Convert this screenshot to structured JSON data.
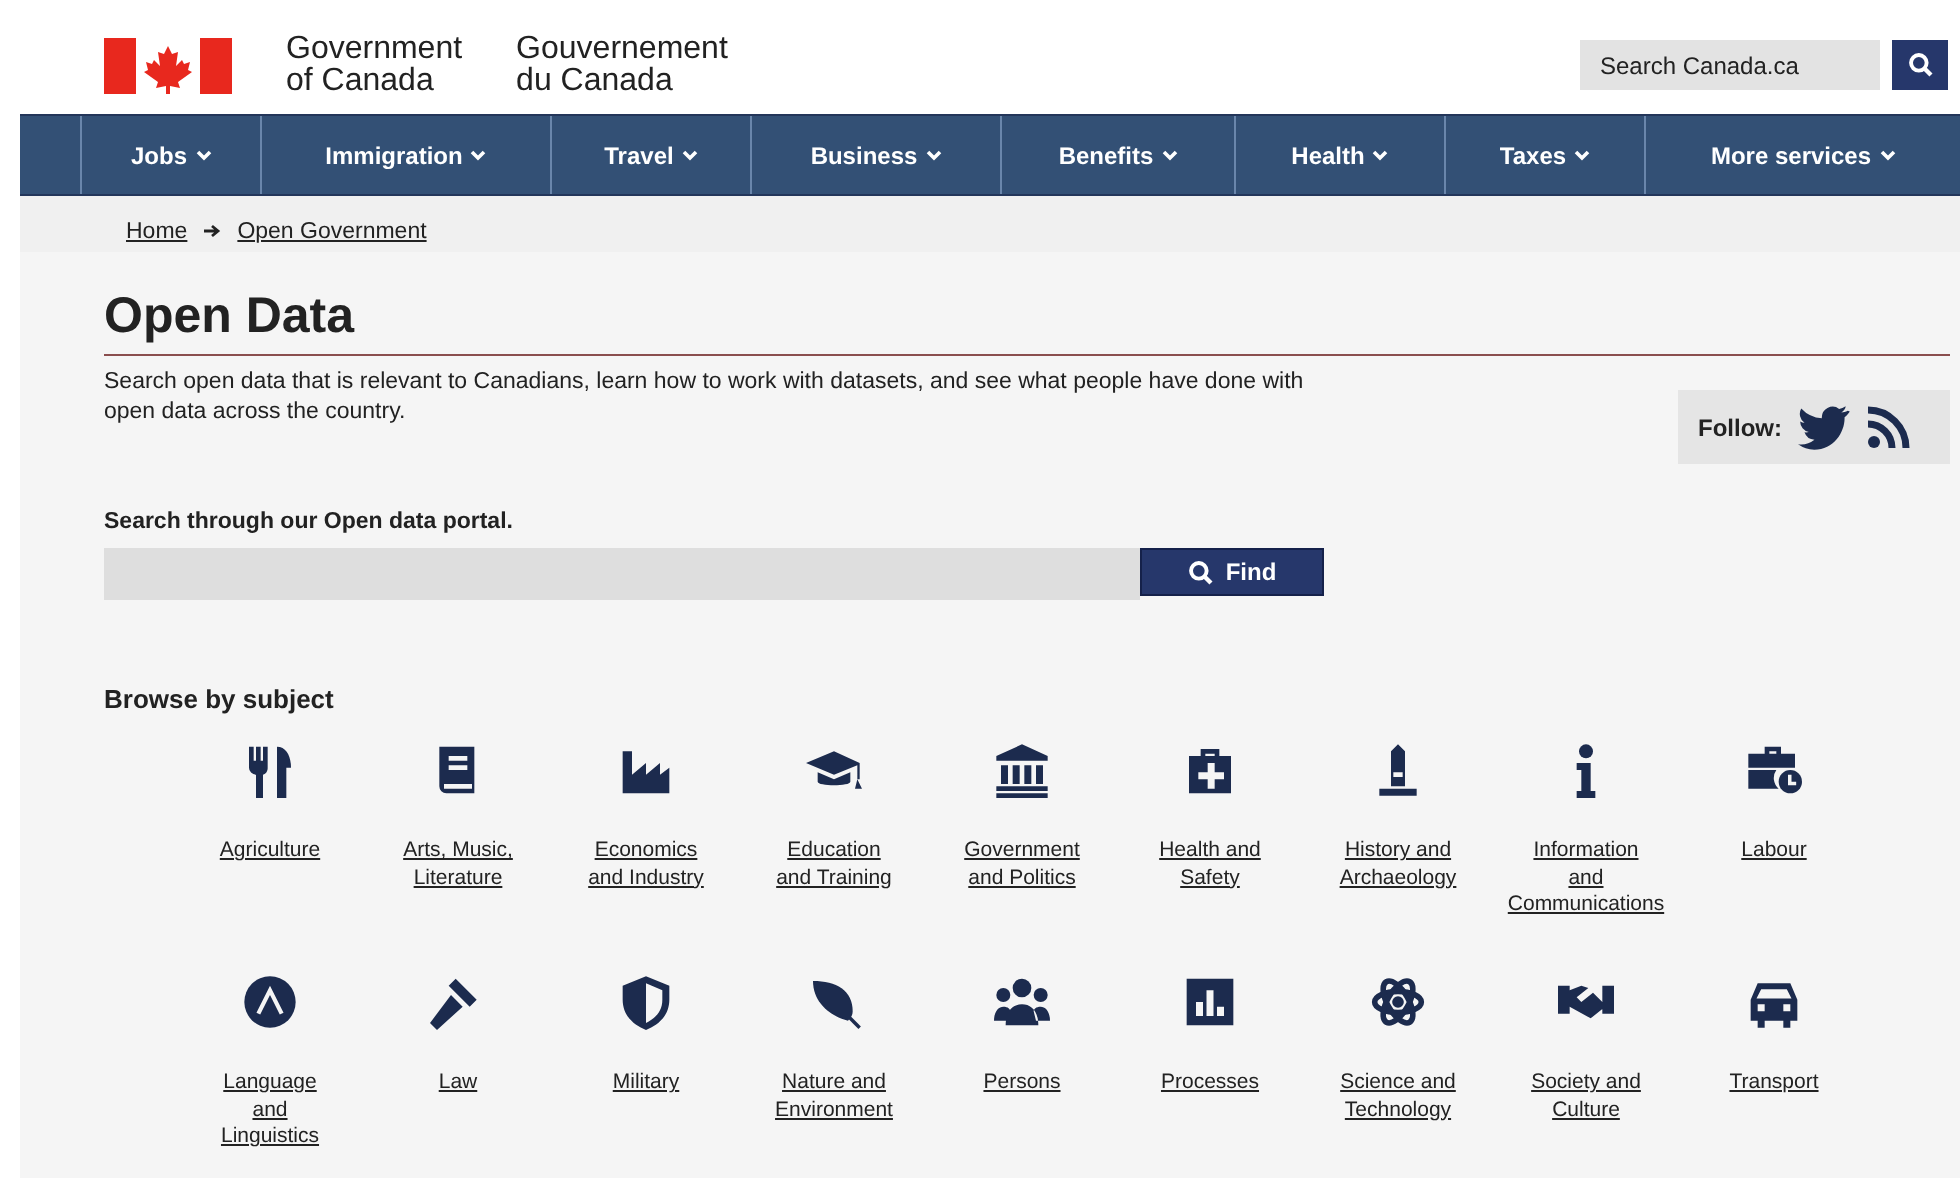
{
  "header": {
    "name_en": "Government\nof Canada",
    "name_fr": "Gouvernement\ndu Canada",
    "search": {
      "placeholder": "Search Canada.ca"
    }
  },
  "nav": [
    "Jobs",
    "Immigration",
    "Travel",
    "Business",
    "Benefits",
    "Health",
    "Taxes",
    "More services"
  ],
  "breadcrumb": [
    "Home",
    "Open Government"
  ],
  "title": "Open Data",
  "intro": "Search open data that is relevant to Canadians, learn how to work with datasets, and see what people have done with open data across the country.",
  "follow": {
    "label": "Follow:"
  },
  "portal": {
    "label": "Search through our Open data portal.",
    "button": "Find"
  },
  "browse": {
    "heading": "Browse by subject",
    "subjects": [
      {
        "label": "Agriculture"
      },
      {
        "label": "Arts, Music,\nLiterature"
      },
      {
        "label": "Economics\nand Industry"
      },
      {
        "label": "Education\nand Training"
      },
      {
        "label": "Government\nand Politics"
      },
      {
        "label": "Health and\nSafety"
      },
      {
        "label": "History and\nArchaeology"
      },
      {
        "label": "Information\nand\nCommunications"
      },
      {
        "label": "Labour"
      },
      {
        "label": "Language\nand\nLinguistics"
      },
      {
        "label": "Law"
      },
      {
        "label": "Military"
      },
      {
        "label": "Nature and\nEnvironment"
      },
      {
        "label": "Persons"
      },
      {
        "label": "Processes"
      },
      {
        "label": "Science and\nTechnology"
      },
      {
        "label": "Society and\nCulture"
      },
      {
        "label": "Transport"
      }
    ]
  }
}
